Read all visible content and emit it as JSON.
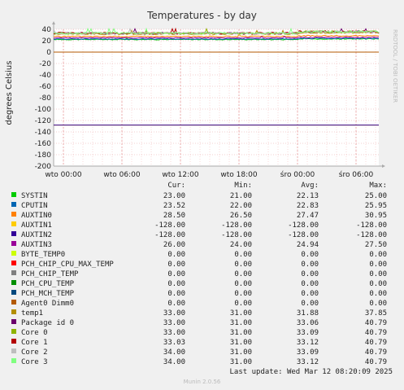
{
  "chart_data": {
    "type": "line",
    "title": "Temperatures - by day",
    "ylabel": "degrees Celsius",
    "side_label": "RRDTOOL / TOBI OETIKER",
    "ylim": [
      -200,
      40
    ],
    "y_ticks": [
      40,
      20,
      0,
      -20,
      -40,
      -60,
      -80,
      -100,
      -120,
      -140,
      -160,
      -180,
      -200
    ],
    "x_tick_labels": [
      "wto 00:00",
      "wto 06:00",
      "wto 12:00",
      "wto 18:00",
      "śro 00:00",
      "śro 06:00"
    ],
    "grid": true,
    "legend_headers": [
      "Cur:",
      "Min:",
      "Avg:",
      "Max:"
    ],
    "series": [
      {
        "name": "SYSTIN",
        "color": "#00cc00",
        "cur": "23.00",
        "min": "21.00",
        "avg": "22.13",
        "max": "25.00"
      },
      {
        "name": "CPUTIN",
        "color": "#0066b3",
        "cur": "23.52",
        "min": "22.00",
        "avg": "22.83",
        "max": "25.95"
      },
      {
        "name": "AUXTIN0",
        "color": "#ff8000",
        "cur": "28.50",
        "min": "26.50",
        "avg": "27.47",
        "max": "30.95"
      },
      {
        "name": "AUXTIN1",
        "color": "#ffcc00",
        "cur": "-128.00",
        "min": "-128.00",
        "avg": "-128.00",
        "max": "-128.00"
      },
      {
        "name": "AUXTIN2",
        "color": "#330099",
        "cur": "-128.00",
        "min": "-128.00",
        "avg": "-128.00",
        "max": "-128.00"
      },
      {
        "name": "AUXTIN3",
        "color": "#990099",
        "cur": "26.00",
        "min": "24.00",
        "avg": "24.94",
        "max": "27.50"
      },
      {
        "name": "BYTE_TEMP0",
        "color": "#ccff00",
        "cur": "0.00",
        "min": "0.00",
        "avg": "0.00",
        "max": "0.00"
      },
      {
        "name": "PCH_CHIP_CPU_MAX_TEMP",
        "color": "#ff0000",
        "cur": "0.00",
        "min": "0.00",
        "avg": "0.00",
        "max": "0.00"
      },
      {
        "name": "PCH_CHIP_TEMP",
        "color": "#808080",
        "cur": "0.00",
        "min": "0.00",
        "avg": "0.00",
        "max": "0.00"
      },
      {
        "name": "PCH_CPU_TEMP",
        "color": "#008f00",
        "cur": "0.00",
        "min": "0.00",
        "avg": "0.00",
        "max": "0.00"
      },
      {
        "name": "PCH_MCH_TEMP",
        "color": "#00487d",
        "cur": "0.00",
        "min": "0.00",
        "avg": "0.00",
        "max": "0.00"
      },
      {
        "name": "Agent0 Dimm0",
        "color": "#b35a00",
        "cur": "0.00",
        "min": "0.00",
        "avg": "0.00",
        "max": "0.00"
      },
      {
        "name": "temp1",
        "color": "#b38f00",
        "cur": "33.00",
        "min": "31.00",
        "avg": "31.88",
        "max": "37.85"
      },
      {
        "name": "Package id 0",
        "color": "#6b006b",
        "cur": "33.00",
        "min": "31.00",
        "avg": "33.06",
        "max": "40.79"
      },
      {
        "name": "Core 0",
        "color": "#8fb300",
        "cur": "33.00",
        "min": "31.00",
        "avg": "33.09",
        "max": "40.79"
      },
      {
        "name": "Core 1",
        "color": "#b30000",
        "cur": "33.03",
        "min": "31.00",
        "avg": "33.12",
        "max": "40.79"
      },
      {
        "name": "Core 2",
        "color": "#bebebe",
        "cur": "34.00",
        "min": "31.00",
        "avg": "33.09",
        "max": "40.79"
      },
      {
        "name": "Core 3",
        "color": "#80ff80",
        "cur": "34.00",
        "min": "31.00",
        "avg": "33.12",
        "max": "40.79"
      }
    ],
    "last_update": "Last update: Wed Mar 12 08:20:09 2025",
    "footer": "Munin 2.0.56"
  }
}
